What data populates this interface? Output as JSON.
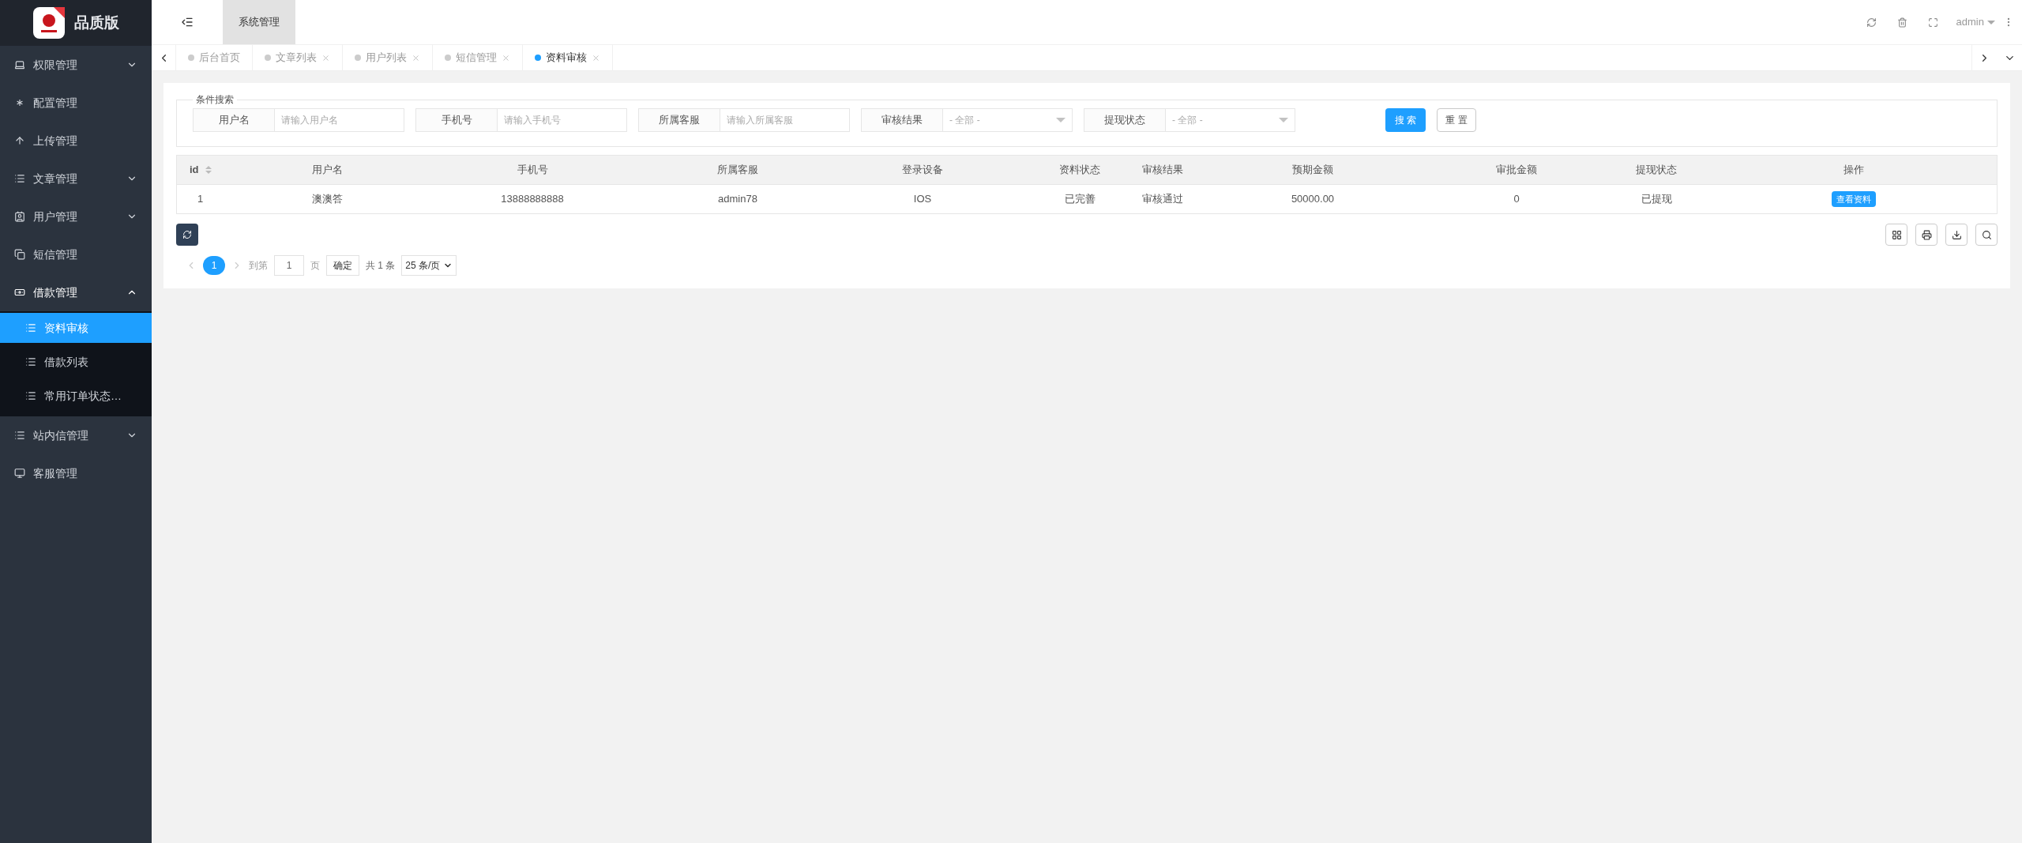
{
  "brand": {
    "title": "品质版"
  },
  "sidebar": {
    "items": [
      {
        "label": "权限管理",
        "expanded": false,
        "has_children": true
      },
      {
        "label": "配置管理",
        "expanded": false,
        "has_children": false
      },
      {
        "label": "上传管理",
        "expanded": false,
        "has_children": false
      },
      {
        "label": "文章管理",
        "expanded": false,
        "has_children": true
      },
      {
        "label": "用户管理",
        "expanded": false,
        "has_children": true
      },
      {
        "label": "短信管理",
        "expanded": false,
        "has_children": false
      },
      {
        "label": "借款管理",
        "expanded": true,
        "has_children": true,
        "children": [
          {
            "label": "资料审核",
            "selected": true
          },
          {
            "label": "借款列表",
            "selected": false
          },
          {
            "label": "常用订单状态…",
            "selected": false
          }
        ]
      },
      {
        "label": "站内信管理",
        "expanded": false,
        "has_children": true
      },
      {
        "label": "客服管理",
        "expanded": false,
        "has_children": false
      }
    ]
  },
  "topbar": {
    "menu_tab": "系统管理",
    "user": "admin"
  },
  "tabs": [
    {
      "label": "后台首页",
      "selected": false,
      "closable": false
    },
    {
      "label": "文章列表",
      "selected": false,
      "closable": true
    },
    {
      "label": "用户列表",
      "selected": false,
      "closable": true
    },
    {
      "label": "短信管理",
      "selected": false,
      "closable": true
    },
    {
      "label": "资料审核",
      "selected": true,
      "closable": true
    }
  ],
  "search": {
    "legend": "条件搜索",
    "fields": [
      {
        "kind": "input",
        "label": "用户名",
        "placeholder": "请输入用户名"
      },
      {
        "kind": "input",
        "label": "手机号",
        "placeholder": "请输入手机号"
      },
      {
        "kind": "input",
        "label": "所属客服",
        "placeholder": "请输入所属客服"
      },
      {
        "kind": "select",
        "label": "审核结果",
        "value": "- 全部 -"
      },
      {
        "kind": "select",
        "label": "提现状态",
        "value": "- 全部 -"
      }
    ],
    "search_button": "搜 索",
    "reset_button": "重 置"
  },
  "table": {
    "columns": [
      "id",
      "用户名",
      "手机号",
      "所属客服",
      "登录设备",
      "资料状态",
      "审核结果",
      "预期金额",
      "审批金额",
      "提现状态",
      "操作"
    ],
    "rows": [
      {
        "cells": [
          "1",
          "澳澳答",
          "13888888888",
          "admin78",
          "IOS",
          "已完善",
          "审核通过",
          "50000.00",
          "0",
          "已提现"
        ],
        "action": "查看资料"
      }
    ]
  },
  "pagination": {
    "current": "1",
    "goto_label": "到第",
    "goto_value": "1",
    "page_label": "页",
    "confirm": "确定",
    "total": "共 1 条",
    "page_size": "25 条/页"
  }
}
